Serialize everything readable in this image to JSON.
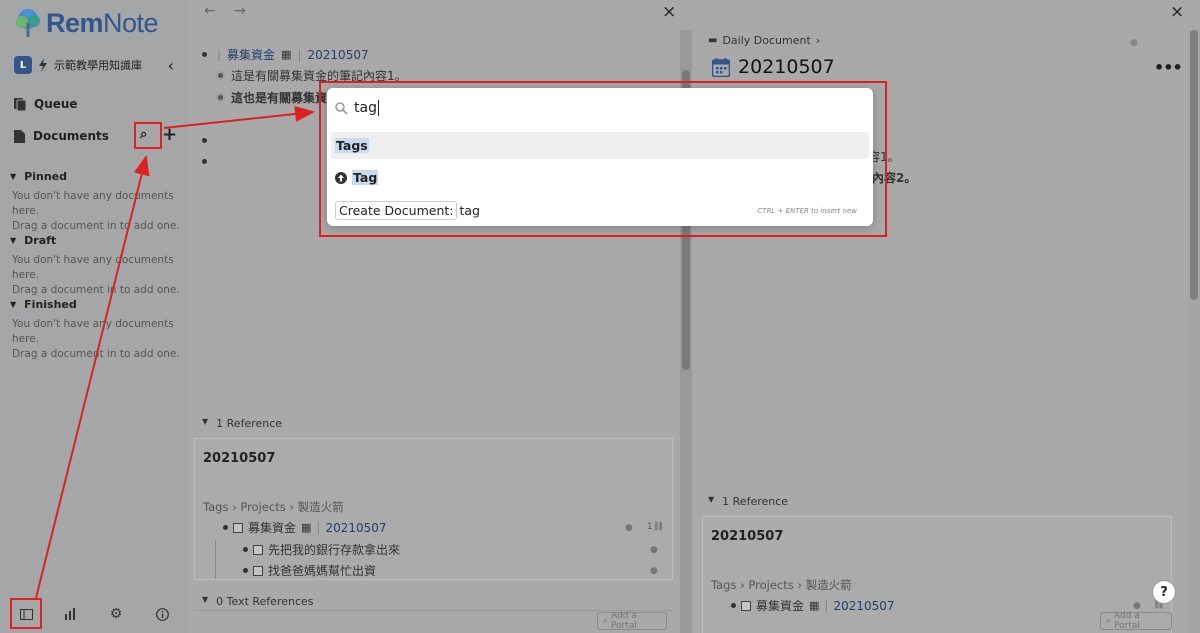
{
  "sidebar": {
    "logo": {
      "rem": "Rem",
      "note": "Note"
    },
    "kb_avatar": "L",
    "kb_name": "示範教學用知識庫",
    "queue": "Queue",
    "documents": "Documents",
    "sections": [
      {
        "title": "Pinned",
        "empty1": "You don't have any documents here.",
        "empty2": "Drag a document in to add one."
      },
      {
        "title": "Draft",
        "empty1": "You don't have any documents here.",
        "empty2": "Drag a document in to add one."
      },
      {
        "title": "Finished",
        "empty1": "You don't have any documents here.",
        "empty2": "Drag a document in to add one."
      }
    ]
  },
  "pane1": {
    "doc_title": "募集資金",
    "doc_date": "20210507",
    "line1": "這是有關募集資金的筆記內容1。",
    "line2": "這也是有關募集資",
    "references_label": "1 Reference",
    "ref_title": "20210507",
    "ref_crumbs": [
      "Tags",
      "Projects",
      "製造火箭"
    ],
    "ref_item": "募集資金",
    "ref_item_date": "20210507",
    "ref_children": [
      "先把我的銀行存款拿出來",
      "找爸爸媽媽幫忙出資"
    ],
    "text_refs_label": "0 Text References",
    "add_portal": "Add a Portal"
  },
  "pane2": {
    "breadcrumb": "Daily Document",
    "title": "20210507",
    "line1_tail": "容1。",
    "line2_tail": "記內容2。",
    "references_label": "1 Reference",
    "ref_title": "20210507",
    "ref_crumbs": [
      "Tags",
      "Projects",
      "製造火箭"
    ],
    "ref_item": "募集資金",
    "ref_item_date": "20210507",
    "add_portal": "Add a Portal",
    "help": "?"
  },
  "popup": {
    "query": "tag",
    "result1": "Tags",
    "result2": "Tag",
    "create_label": "Create Document:",
    "create_value": "tag",
    "hint": "CTRL + ENTER to insert new"
  },
  "colors": {
    "brand": "#34548c",
    "annotation": "#e02020"
  }
}
